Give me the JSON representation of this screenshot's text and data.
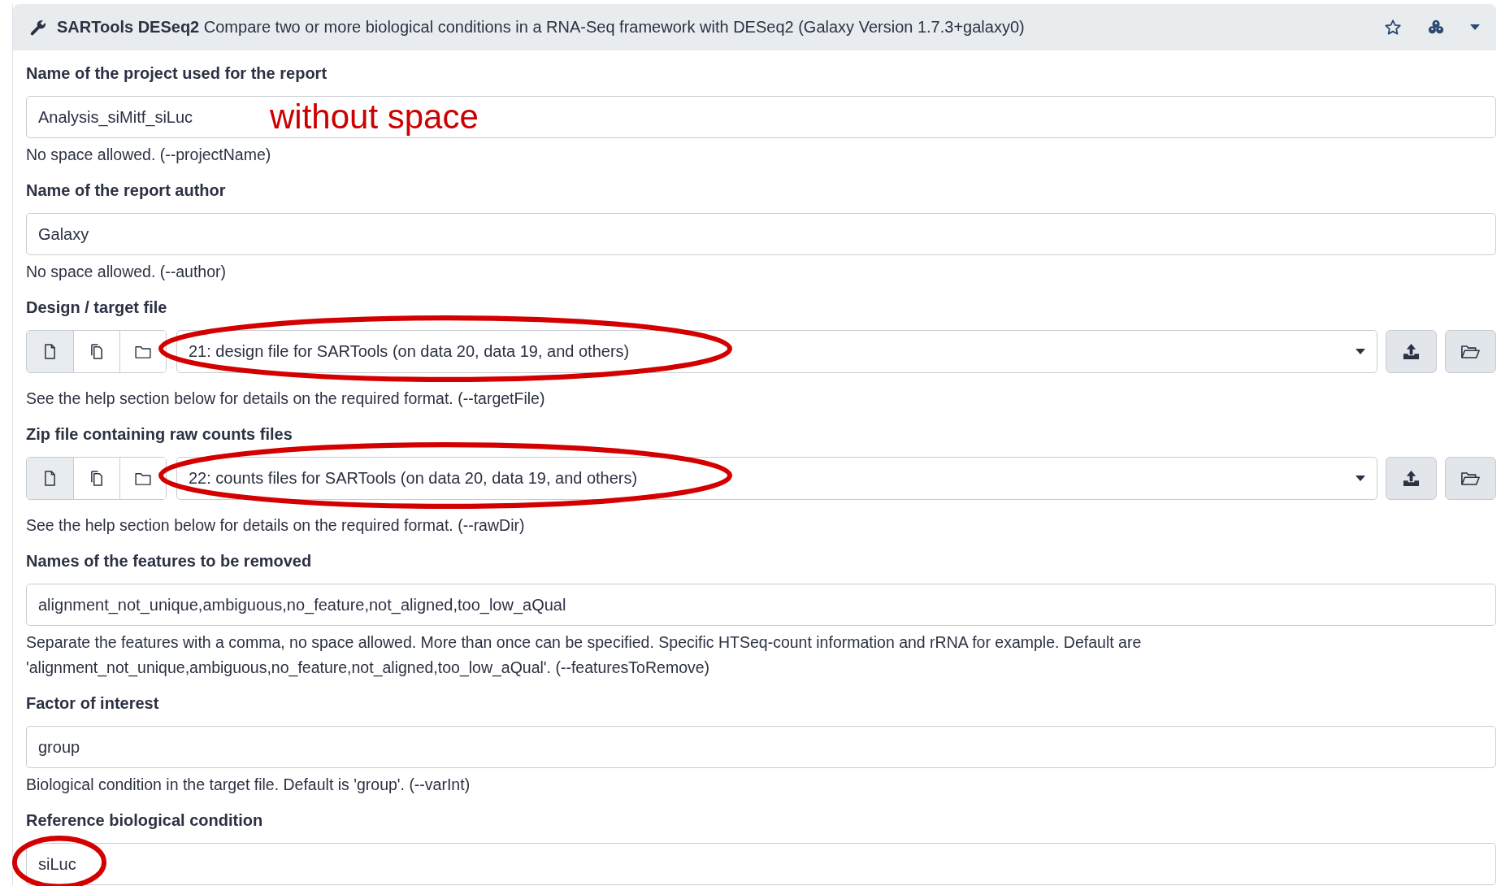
{
  "header": {
    "tool_name": "SARTools DESeq2",
    "description": "Compare two or more biological conditions in a RNA-Seq framework with DESeq2 (Galaxy Version 1.7.3+galaxy0)"
  },
  "fields": [
    {
      "kind": "text",
      "label": "Name of the project used for the report",
      "value": "Analysis_siMitf_siLuc",
      "note": "without space",
      "circled": false,
      "help": "No space allowed. (--projectName)"
    },
    {
      "kind": "text",
      "label": "Name of the report author",
      "value": "Galaxy",
      "circled": false,
      "help": "No space allowed. (--author)"
    },
    {
      "kind": "data",
      "label": "Design / target file",
      "value": "21: design file for SARTools (on data 20, data 19, and others)",
      "circled": true,
      "modes": [
        {
          "selected": true
        },
        {
          "selected": false
        },
        {
          "selected": false
        }
      ],
      "help": "See the help section below for details on the required format. (--targetFile)"
    },
    {
      "kind": "data",
      "label": "Zip file containing raw counts files",
      "value": "22: counts files for SARTools (on data 20, data 19, and others)",
      "circled": true,
      "modes": [
        {
          "selected": true
        },
        {
          "selected": false
        },
        {
          "selected": false
        }
      ],
      "help": "See the help section below for details on the required format. (--rawDir)"
    },
    {
      "kind": "text",
      "label": "Names of the features to be removed",
      "value": "alignment_not_unique,ambiguous,no_feature,not_aligned,too_low_aQual",
      "circled": false,
      "help": "Separate the features with a comma, no space allowed. More than once can be specified. Specific HTSeq-count information and rRNA for example. Default are 'alignment_not_unique,ambiguous,no_feature,not_aligned,too_low_aQual'. (--featuresToRemove)"
    },
    {
      "kind": "text",
      "label": "Factor of interest",
      "value": "group",
      "circled": false,
      "help": "Biological condition in the target file. Default is 'group'. (--varInt)"
    },
    {
      "kind": "text",
      "label": "Reference biological condition",
      "value": "siLuc",
      "circled": true
    }
  ]
}
